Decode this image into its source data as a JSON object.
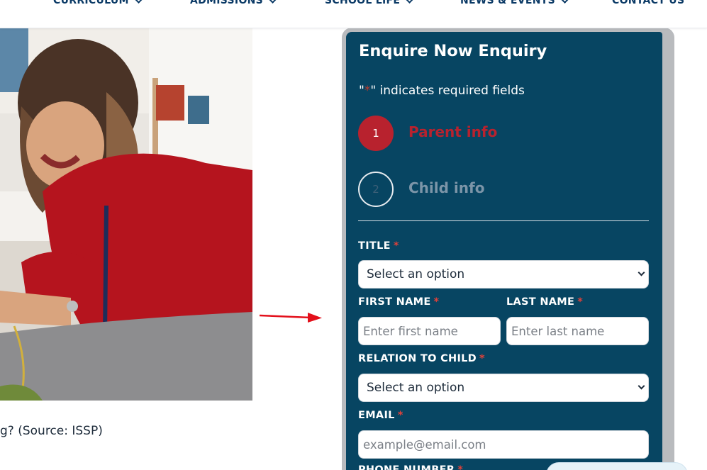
{
  "nav": {
    "items": [
      {
        "label": "CURRICULUM"
      },
      {
        "label": "ADMISSIONS"
      },
      {
        "label": "SCHOOL LIFE"
      },
      {
        "label": "NEWS & EVENTS"
      },
      {
        "label": "CONTACT US"
      }
    ]
  },
  "article": {
    "caption": "g? (Source: ISSP)"
  },
  "form": {
    "title": "Enquire Now Enquiry",
    "required_note_prefix": "\"",
    "required_star": "*",
    "required_note_suffix": "\" indicates required fields",
    "steps": [
      {
        "number": "1",
        "label": "Parent info",
        "active": true
      },
      {
        "number": "2",
        "label": "Child info",
        "active": false
      }
    ],
    "fields": {
      "title": {
        "label": "TITLE",
        "value": "Select an option"
      },
      "first_name": {
        "label": "FIRST NAME",
        "placeholder": "Enter first name"
      },
      "last_name": {
        "label": "LAST NAME",
        "placeholder": "Enter last name"
      },
      "relation": {
        "label": "RELATION TO CHILD",
        "value": "Select an option"
      },
      "email": {
        "label": "EMAIL",
        "placeholder": "example@email.com"
      },
      "phone": {
        "label": "PHONE NUMBER"
      }
    }
  },
  "colors": {
    "nav_text": "#0b3a66",
    "form_background": "#074562",
    "form_frame": "#b9bbbe",
    "active_step": "#b8222e",
    "inactive_step": "#7c95a8",
    "required_star": "#e0413a",
    "annotation_arrow": "#e3101b"
  }
}
